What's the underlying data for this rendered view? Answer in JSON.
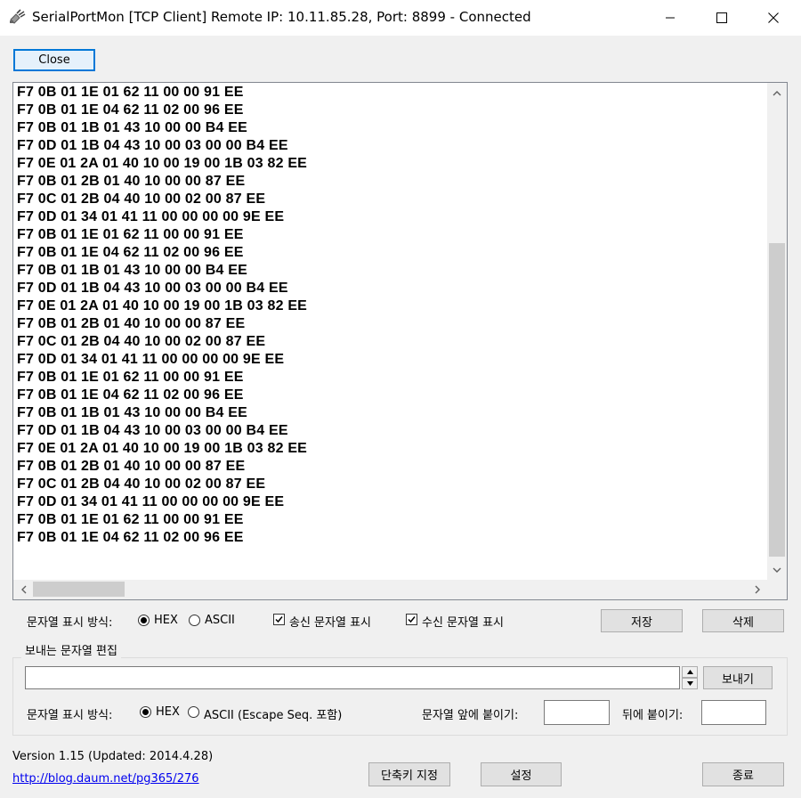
{
  "window": {
    "title": "SerialPortMon [TCP Client] Remote IP: 10.11.85.28, Port: 8899 - Connected",
    "icons": {
      "app": "serial-plug-icon",
      "minimize": "minimize-icon",
      "maximize": "maximize-icon",
      "close": "close-icon"
    }
  },
  "toolbar": {
    "close_label": "Close"
  },
  "log": {
    "lines": [
      "F7 0B 01 1E 01 62 11 00 00 91 EE",
      "F7 0B 01 1E 04 62 11 02 00 96 EE",
      "F7 0B 01 1B 01 43 10 00 00 B4 EE",
      "F7 0D 01 1B 04 43 10 00 03 00 00 B4 EE",
      "F7 0E 01 2A 01 40 10 00 19 00 1B 03 82 EE",
      "F7 0B 01 2B 01 40 10 00 00 87 EE",
      "F7 0C 01 2B 04 40 10 00 02 00 87 EE",
      "F7 0D 01 34 01 41 11 00 00 00 00 9E EE",
      "F7 0B 01 1E 01 62 11 00 00 91 EE",
      "F7 0B 01 1E 04 62 11 02 00 96 EE",
      "F7 0B 01 1B 01 43 10 00 00 B4 EE",
      "F7 0D 01 1B 04 43 10 00 03 00 00 B4 EE",
      "F7 0E 01 2A 01 40 10 00 19 00 1B 03 82 EE",
      "F7 0B 01 2B 01 40 10 00 00 87 EE",
      "F7 0C 01 2B 04 40 10 00 02 00 87 EE",
      "F7 0D 01 34 01 41 11 00 00 00 00 9E EE",
      "F7 0B 01 1E 01 62 11 00 00 91 EE",
      "F7 0B 01 1E 04 62 11 02 00 96 EE",
      "F7 0B 01 1B 01 43 10 00 00 B4 EE",
      "F7 0D 01 1B 04 43 10 00 03 00 00 B4 EE",
      "F7 0E 01 2A 01 40 10 00 19 00 1B 03 82 EE",
      "F7 0B 01 2B 01 40 10 00 00 87 EE",
      "F7 0C 01 2B 04 40 10 00 02 00 87 EE",
      "F7 0D 01 34 01 41 11 00 00 00 00 9E EE",
      "F7 0B 01 1E 01 62 11 00 00 91 EE",
      "F7 0B 01 1E 04 62 11 02 00 96 EE"
    ]
  },
  "display_options": {
    "mode_label": "문자열 표시 방식:",
    "hex_label": "HEX",
    "ascii_label": "ASCII",
    "hex_selected": true,
    "show_sent_label": "송신 문자열 표시",
    "show_sent_checked": true,
    "show_received_label": "수신 문자열 표시",
    "show_received_checked": true,
    "save_label": "저장",
    "delete_label": "삭제"
  },
  "send_group": {
    "title": "보내는 문자열 편집",
    "input_value": "",
    "send_label": "보내기",
    "mode_label": "문자열 표시 방식:",
    "hex_label": "HEX",
    "ascii_label": "ASCII (Escape Seq. 포함)",
    "hex_selected": true,
    "prefix_label": "문자열 앞에 붙이기:",
    "prefix_value": "",
    "suffix_label": "뒤에 붙이기:",
    "suffix_value": ""
  },
  "footer": {
    "version": "Version 1.15 (Updated: 2014.4.28)",
    "link": "http://blog.daum.net/pg365/276",
    "shortcut_label": "단축키 지정",
    "settings_label": "설정",
    "exit_label": "종료"
  },
  "colors": {
    "accent": "#0078d7",
    "link": "#0000ee",
    "window_bg": "#f0f0f0"
  }
}
